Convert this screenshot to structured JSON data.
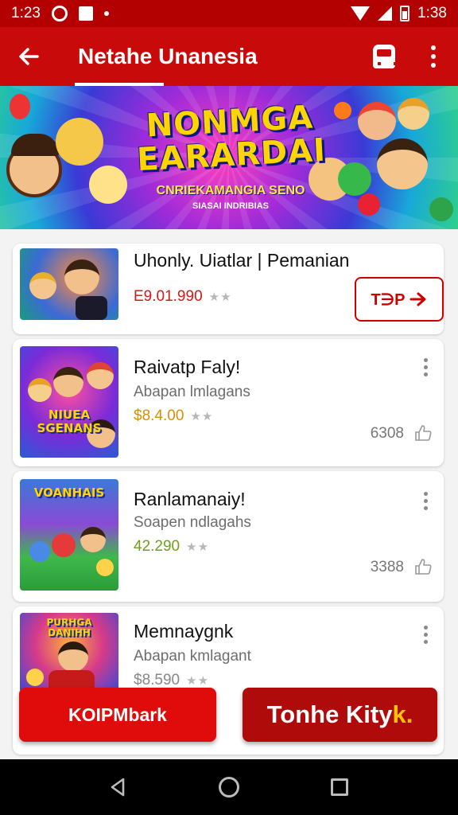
{
  "status_bar": {
    "time_left": "1:23",
    "time_right": "1:38"
  },
  "app_bar": {
    "title": "Netahe Unanesia"
  },
  "banner": {
    "title_line1": "NONMGA",
    "title_line2": "EARARDAI",
    "subtitle": "CNRIEKAMANGIA SENO",
    "tagline": "SIASAI INDRIBIAS"
  },
  "items": [
    {
      "title": "Uhonly. Uiatlar | Pemanian",
      "price": "E9.01.990",
      "button_label": "T∋P",
      "price_color": "#d21a1a"
    },
    {
      "title": "Raivatp Faly!",
      "subtitle": "Abapan lmlagans",
      "price": "$8.4.00",
      "count": "6308",
      "thumb_text": "NIUEA SGENANS",
      "price_color": "#d98f00"
    },
    {
      "title": "Ranlamanaiy!",
      "subtitle": "Soapen ndlagahs",
      "price": "42.290",
      "count": "3388",
      "thumb_text": "VOANHAIS",
      "price_color": "#6f9f1b"
    },
    {
      "title": "Memnaygnk",
      "subtitle": "Abapan kmlagant",
      "price": "$8.590",
      "thumb_text": "PURHGA DANIHH",
      "price_color": "#888888"
    }
  ],
  "bottom_buttons": {
    "left_label": "KOIPMbark",
    "right_label": "Tonhe Kity",
    "right_accent": "k."
  },
  "colors": {
    "primary": "#c90a0a",
    "status": "#b30000",
    "accent_yellow": "#ffc400"
  }
}
